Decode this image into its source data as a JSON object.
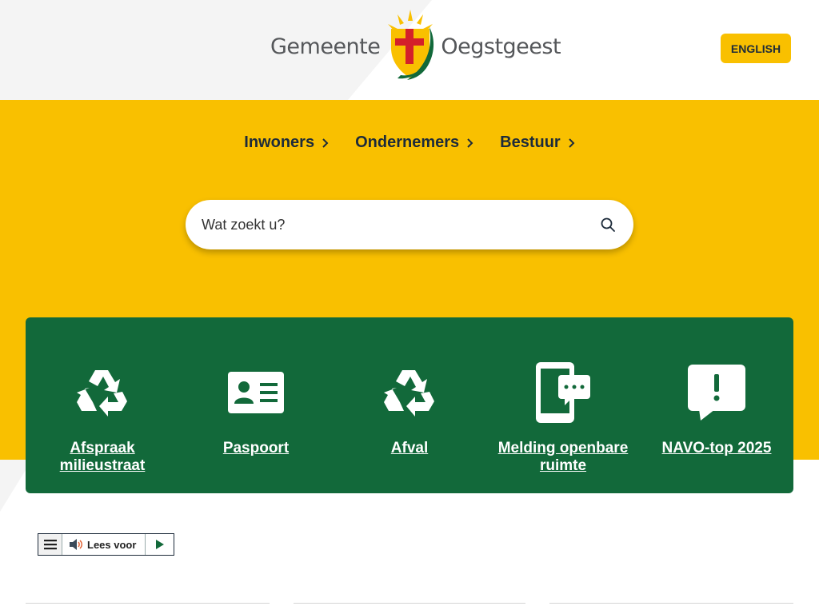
{
  "header": {
    "logo_left": "Gemeente",
    "logo_right": "Oegstgeest",
    "language_button": "ENGLISH"
  },
  "nav": {
    "items": [
      {
        "label": "Inwoners"
      },
      {
        "label": "Ondernemers"
      },
      {
        "label": "Bestuur"
      }
    ]
  },
  "search": {
    "placeholder": "Wat zoekt u?",
    "icon": "search-icon"
  },
  "tasks": [
    {
      "label": "Afspraak milieustraat",
      "icon": "recycle-icon"
    },
    {
      "label": "Paspoort",
      "icon": "id-card-icon"
    },
    {
      "label": "Afval",
      "icon": "recycle-icon"
    },
    {
      "label": "Melding openbare ruimte",
      "icon": "phone-message-icon"
    },
    {
      "label": "NAVO-top 2025",
      "icon": "alert-speech-icon"
    }
  ],
  "readspeaker": {
    "listen_label": "Lees voor",
    "menu_icon": "menu-icon",
    "speaker_icon": "speaker-icon",
    "play_icon": "play-icon"
  },
  "colors": {
    "brand_yellow": "#f9c000",
    "brand_green": "#12693a",
    "text_dark": "#1d2b3a"
  }
}
